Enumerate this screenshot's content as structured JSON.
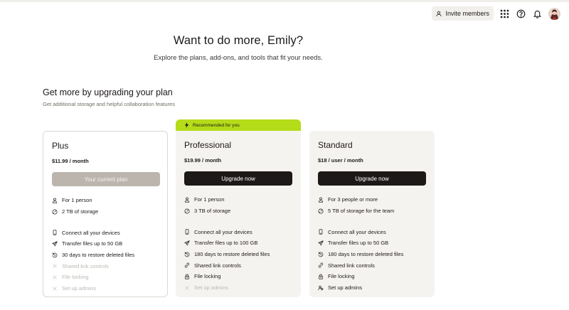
{
  "topbar": {
    "invite_label": "Invite members",
    "icons": [
      "person-plus-icon",
      "app-grid-icon",
      "help-icon",
      "bell-icon"
    ]
  },
  "hero": {
    "title": "Want to do more, Emily?",
    "subtitle": "Explore the plans, add-ons, and tools that fit your needs."
  },
  "section": {
    "title": "Get more by upgrading your plan",
    "subtitle": "Get additional storage and helpful collaboration features"
  },
  "recommended_label": "Recommended for you",
  "colors": {
    "accent_lime": "#b4dc19",
    "dark": "#1e1919",
    "card_bg": "#f5f3f0",
    "disabled_text": "#bdb8b2",
    "current_btn": "#bbb5ae"
  },
  "plans": [
    {
      "name": "Plus",
      "price": "$11.99 / month",
      "button": "Your current plan",
      "core": [
        {
          "icon": "person-icon",
          "text": "For 1 person"
        },
        {
          "icon": "storage-gauge-icon",
          "text": "2 TB of storage"
        }
      ],
      "features": [
        {
          "icon": "device-icon",
          "text": "Connect all your devices",
          "enabled": true
        },
        {
          "icon": "paper-plane-icon",
          "text": "Transfer files up to 50 GB",
          "enabled": true
        },
        {
          "icon": "restore-icon",
          "text": "30 days to restore deleted files",
          "enabled": true
        },
        {
          "icon": "x-icon",
          "text": "Shared link controls",
          "enabled": false
        },
        {
          "icon": "x-icon",
          "text": "File locking",
          "enabled": false
        },
        {
          "icon": "x-icon",
          "text": "Set up admins",
          "enabled": false
        }
      ]
    },
    {
      "name": "Professional",
      "price": "$19.99 / month",
      "button": "Upgrade now",
      "core": [
        {
          "icon": "person-icon",
          "text": "For 1 person"
        },
        {
          "icon": "storage-gauge-icon",
          "text": "3 TB of storage"
        }
      ],
      "features": [
        {
          "icon": "device-icon",
          "text": "Connect all your devices",
          "enabled": true
        },
        {
          "icon": "paper-plane-icon",
          "text": "Transfer files up to 100 GB",
          "enabled": true
        },
        {
          "icon": "restore-icon",
          "text": "180 days to restore deleted files",
          "enabled": true
        },
        {
          "icon": "link-icon",
          "text": "Shared link controls",
          "enabled": true
        },
        {
          "icon": "lock-icon",
          "text": "File locking",
          "enabled": true
        },
        {
          "icon": "x-icon",
          "text": "Set up admins",
          "enabled": false
        }
      ]
    },
    {
      "name": "Standard",
      "price": "$18 / user / month",
      "button": "Upgrade now",
      "core": [
        {
          "icon": "person-icon",
          "text": "For 3 people or more"
        },
        {
          "icon": "storage-gauge-icon",
          "text": "5 TB of storage for the team"
        }
      ],
      "features": [
        {
          "icon": "device-icon",
          "text": "Connect all your devices",
          "enabled": true
        },
        {
          "icon": "paper-plane-icon",
          "text": "Transfer files up to 50 GB",
          "enabled": true
        },
        {
          "icon": "restore-icon",
          "text": "180 days to restore deleted files",
          "enabled": true
        },
        {
          "icon": "link-icon",
          "text": "Shared link controls",
          "enabled": true
        },
        {
          "icon": "lock-icon",
          "text": "File locking",
          "enabled": true
        },
        {
          "icon": "admins-icon",
          "text": "Set up admins",
          "enabled": true
        }
      ]
    }
  ]
}
